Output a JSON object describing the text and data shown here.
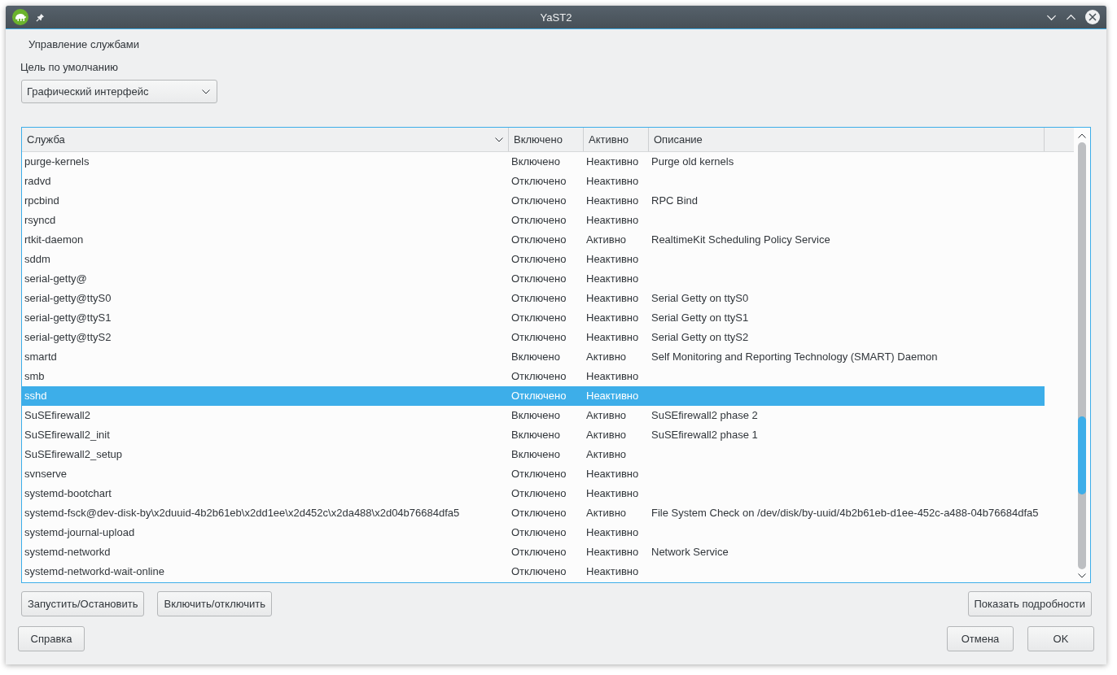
{
  "window": {
    "title": "YaST2"
  },
  "heading": "Управление службами",
  "default_target": {
    "label": "Цель по умолчанию",
    "value": "Графический интерфейс"
  },
  "table": {
    "columns": [
      {
        "label": "Служба",
        "sorted": true
      },
      {
        "label": "Включено",
        "sorted": false
      },
      {
        "label": "Активно",
        "sorted": false
      },
      {
        "label": "Описание",
        "sorted": false
      }
    ],
    "rows": [
      {
        "service": "purge-kernels",
        "enabled": "Включено",
        "active": "Неактивно",
        "description": "Purge old kernels",
        "selected": false
      },
      {
        "service": "radvd",
        "enabled": "Отключено",
        "active": "Неактивно",
        "selected": false
      },
      {
        "service": "rpcbind",
        "enabled": "Отключено",
        "active": "Неактивно",
        "description": "RPC Bind",
        "selected": false
      },
      {
        "service": "rsyncd",
        "enabled": "Отключено",
        "active": "Неактивно",
        "selected": false
      },
      {
        "service": "rtkit-daemon",
        "enabled": "Отключено",
        "active": "Активно",
        "description": "RealtimeKit Scheduling Policy Service",
        "selected": false
      },
      {
        "service": "sddm",
        "enabled": "Отключено",
        "active": "Неактивно",
        "selected": false
      },
      {
        "service": "serial-getty@",
        "enabled": "Отключено",
        "active": "Неактивно",
        "selected": false
      },
      {
        "service": "serial-getty@ttyS0",
        "enabled": "Отключено",
        "active": "Неактивно",
        "description": "Serial Getty on ttyS0",
        "selected": false
      },
      {
        "service": "serial-getty@ttyS1",
        "enabled": "Отключено",
        "active": "Неактивно",
        "description": "Serial Getty on ttyS1",
        "selected": false
      },
      {
        "service": "serial-getty@ttyS2",
        "enabled": "Отключено",
        "active": "Неактивно",
        "description": "Serial Getty on ttyS2",
        "selected": false
      },
      {
        "service": "smartd",
        "enabled": "Включено",
        "active": "Активно",
        "description": "Self Monitoring and Reporting Technology (SMART) Daemon",
        "selected": false
      },
      {
        "service": "smb",
        "enabled": "Отключено",
        "active": "Неактивно",
        "selected": false
      },
      {
        "service": "sshd",
        "enabled": "Отключено",
        "active": "Неактивно",
        "selected": true
      },
      {
        "service": "SuSEfirewall2",
        "enabled": "Включено",
        "active": "Активно",
        "description": "SuSEfirewall2 phase 2",
        "selected": false
      },
      {
        "service": "SuSEfirewall2_init",
        "enabled": "Включено",
        "active": "Активно",
        "description": "SuSEfirewall2 phase 1",
        "selected": false
      },
      {
        "service": "SuSEfirewall2_setup",
        "enabled": "Включено",
        "active": "Активно",
        "selected": false
      },
      {
        "service": "svnserve",
        "enabled": "Отключено",
        "active": "Неактивно",
        "selected": false
      },
      {
        "service": "systemd-bootchart",
        "enabled": "Отключено",
        "active": "Неактивно",
        "selected": false
      },
      {
        "service": "systemd-fsck@dev-disk-by\\x2duuid-4b2b61eb\\x2dd1ee\\x2d452c\\x2da488\\x2d04b76684dfa5",
        "enabled": "Отключено",
        "active": "Активно",
        "description": "File System Check on /dev/disk/by-uuid/4b2b61eb-d1ee-452c-a488-04b76684dfa5",
        "selected": false
      },
      {
        "service": "systemd-journal-upload",
        "enabled": "Отключено",
        "active": "Неактивно",
        "selected": false
      },
      {
        "service": "systemd-networkd",
        "enabled": "Отключено",
        "active": "Неактивно",
        "description": "Network Service",
        "selected": false
      },
      {
        "service": "systemd-networkd-wait-online",
        "enabled": "Отключено",
        "active": "Неактивно",
        "selected": false
      }
    ]
  },
  "actions": {
    "left": [
      "Запустить/Остановить",
      "Включить/отключить"
    ],
    "right": [
      "Показать подробности"
    ]
  },
  "dialog_buttons": {
    "left": [
      "Справка"
    ],
    "right": [
      "Отмена",
      "OK"
    ]
  }
}
